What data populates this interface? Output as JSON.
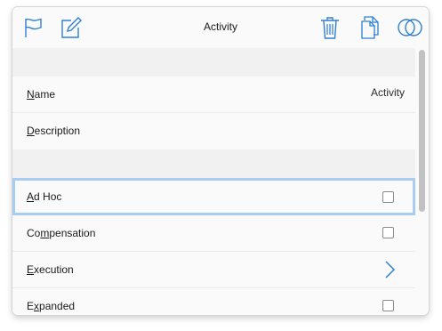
{
  "toolbar": {
    "title": "Activity",
    "icons": [
      "flag-icon",
      "edit-icon",
      "trash-icon",
      "copy-icon",
      "overlap-circles-icon"
    ],
    "accent": "#2f80d1"
  },
  "properties": {
    "name": {
      "label_initial": "N",
      "label_rest": "ame",
      "value": "Activity"
    },
    "description": {
      "label_initial": "D",
      "label_rest": "escription",
      "value": ""
    },
    "ad_hoc": {
      "label_initial": "A",
      "label_rest": "d Hoc",
      "checked": false
    },
    "compensation": {
      "label_prefix": "Co",
      "label_initial": "m",
      "label_rest": "pensation",
      "checked": false
    },
    "execution": {
      "label_initial": "E",
      "label_rest": "xecution",
      "control": "chevron-right-icon"
    },
    "expanded": {
      "label_prefix": "E",
      "label_initial": "x",
      "label_rest": "panded",
      "checked": false
    }
  },
  "colors": {
    "selected_outline": "#a9ccf2",
    "section_bg": "#f1f1f1"
  }
}
